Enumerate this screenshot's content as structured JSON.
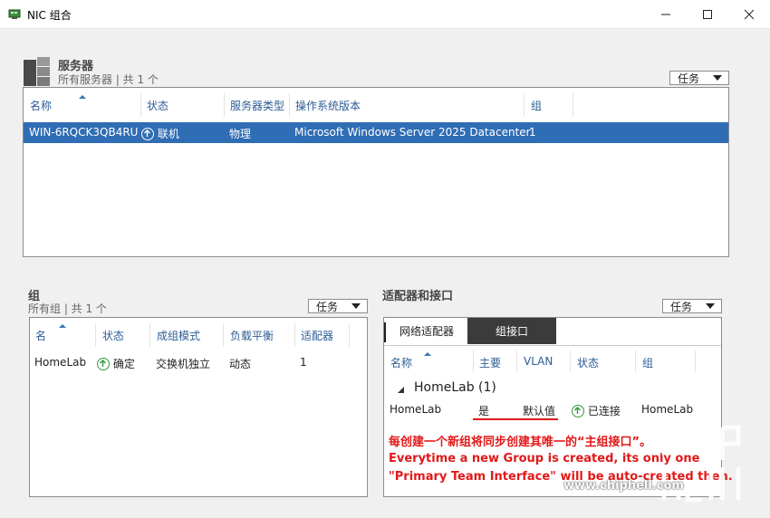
{
  "window": {
    "title": "NIC 组合",
    "controls": {
      "minimize": "—",
      "maximize": "☐",
      "close": "✕"
    }
  },
  "servers": {
    "title": "服务器",
    "subtitle": "所有服务器 | 共 1 个",
    "task_label": "任务",
    "columns": [
      "名称",
      "状态",
      "服务器类型",
      "操作系统版本",
      "组"
    ],
    "rows": [
      {
        "name": "WIN-6RQCK3QB4RU",
        "status": "联机",
        "type": "物理",
        "os": "Microsoft Windows Server 2025 Datacenter",
        "groups": "1"
      }
    ]
  },
  "teams": {
    "title": "组",
    "subtitle": "所有组 | 共 1 个",
    "task_label": "任务",
    "columns": [
      "名",
      "状态",
      "成组模式",
      "负载平衡",
      "适配器"
    ],
    "rows": [
      {
        "name": "HomeLab",
        "status": "确定",
        "mode": "交换机独立",
        "lb": "动态",
        "adapters": "1"
      }
    ]
  },
  "adapters": {
    "title": "适配器和接口",
    "task_label": "任务",
    "tabs": [
      {
        "label": "网络适配器",
        "active": false
      },
      {
        "label": "组接口",
        "active": true
      }
    ],
    "columns": [
      "名称",
      "主要",
      "VLAN",
      "状态",
      "组"
    ],
    "group_label": "HomeLab (1)",
    "rows": [
      {
        "name": "HomeLab",
        "primary": "是",
        "vlan": "默认值",
        "status": "已连接",
        "team": "HomeLab"
      }
    ]
  },
  "annotation": {
    "line1": "每创建一个新组将同步创建其唯一的“主组接口”。",
    "line2": "Everytime a new Group is created, its only one",
    "line3": "\"Primary Team Interface\" will be auto-created then."
  },
  "watermark": {
    "logo": "chip hell",
    "url": "www.chiphell.com"
  },
  "colors": {
    "selection": "#2f6db4",
    "header_text": "#2d5d94",
    "status_green": "#2e9b3c",
    "annotation_red": "#e21818"
  }
}
